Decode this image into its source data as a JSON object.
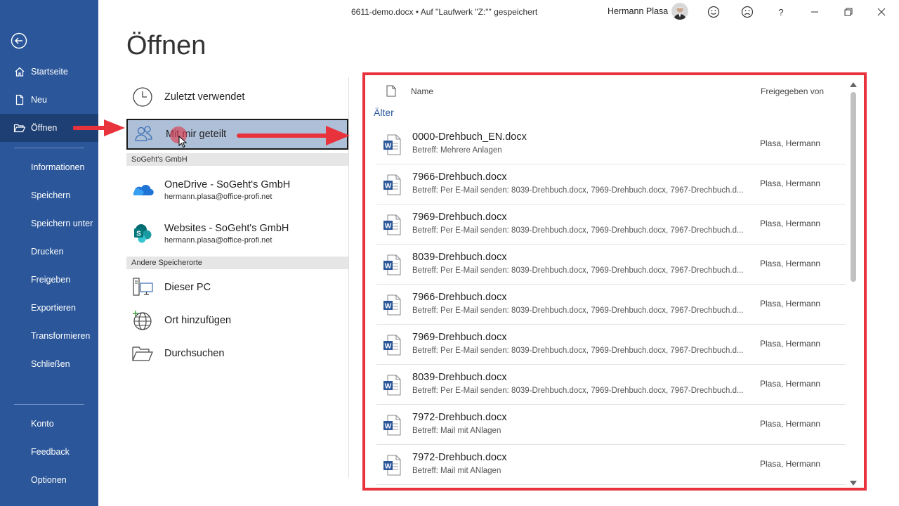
{
  "window": {
    "doc_title": "6611-demo.docx • Auf \"Laufwerk \"Z:\"\" gespeichert",
    "user_name": "Hermann Plasa",
    "buttons": {
      "smile": "smile-icon",
      "frown": "frown-icon",
      "help": "?",
      "minimize": "minimize-icon",
      "restore": "restore-icon",
      "close": "close-icon"
    }
  },
  "sidebar": {
    "top_items": [
      {
        "label": "Startseite",
        "icon": "home-icon"
      },
      {
        "label": "Neu",
        "icon": "new-document-icon"
      },
      {
        "label": "Öffnen",
        "icon": "open-folder-icon",
        "active": true
      }
    ],
    "mid_items": [
      {
        "label": "Informationen"
      },
      {
        "label": "Speichern"
      },
      {
        "label": "Speichern unter"
      },
      {
        "label": "Drucken"
      },
      {
        "label": "Freigeben"
      },
      {
        "label": "Exportieren"
      },
      {
        "label": "Transformieren"
      },
      {
        "label": "Schließen"
      }
    ],
    "bottom_items": [
      {
        "label": "Konto"
      },
      {
        "label": "Feedback"
      },
      {
        "label": "Optionen"
      }
    ]
  },
  "page": {
    "title": "Öffnen"
  },
  "locations": {
    "recent": "Zuletzt verwendet",
    "shared": "Mit mir geteilt",
    "section_org": "SoGeht's GmbH",
    "onedrive": {
      "label": "OneDrive - SoGeht's GmbH",
      "sub": "hermann.plasa@office-profi.net"
    },
    "sites": {
      "label": "Websites - SoGeht's GmbH",
      "sub": "hermann.plasa@office-profi.net"
    },
    "section_other": "Andere Speicherorte",
    "this_pc": "Dieser PC",
    "add_place": "Ort hinzufügen",
    "browse": "Durchsuchen"
  },
  "files": {
    "col_name": "Name",
    "col_shared_by": "Freigegeben von",
    "group": "Älter",
    "rows": [
      {
        "name": "0000-Drehbuch_EN.docx",
        "sub": "Betreff: Mehrere Anlagen",
        "owner": "Plasa, Hermann"
      },
      {
        "name": "7966-Drehbuch.docx",
        "sub": "Betreff: Per E-Mail senden: 8039-Drehbuch.docx, 7969-Drehbuch.docx, 7967-Drechbuch.d...",
        "owner": "Plasa, Hermann"
      },
      {
        "name": "7969-Drehbuch.docx",
        "sub": "Betreff: Per E-Mail senden: 8039-Drehbuch.docx, 7969-Drehbuch.docx, 7967-Drechbuch.d...",
        "owner": "Plasa, Hermann"
      },
      {
        "name": "8039-Drehbuch.docx",
        "sub": "Betreff: Per E-Mail senden: 8039-Drehbuch.docx, 7969-Drehbuch.docx, 7967-Drechbuch.d...",
        "owner": "Plasa, Hermann"
      },
      {
        "name": "7966-Drehbuch.docx",
        "sub": "Betreff: Per E-Mail senden: 8039-Drehbuch.docx, 7969-Drehbuch.docx, 7967-Drechbuch.d...",
        "owner": "Plasa, Hermann"
      },
      {
        "name": "7969-Drehbuch.docx",
        "sub": "Betreff: Per E-Mail senden: 8039-Drehbuch.docx, 7969-Drehbuch.docx, 7967-Drechbuch.d...",
        "owner": "Plasa, Hermann"
      },
      {
        "name": "8039-Drehbuch.docx",
        "sub": "Betreff: Per E-Mail senden: 8039-Drehbuch.docx, 7969-Drehbuch.docx, 7967-Drechbuch.d...",
        "owner": "Plasa, Hermann"
      },
      {
        "name": "7972-Drehbuch.docx",
        "sub": "Betreff: Mail mit ANlagen",
        "owner": "Plasa, Hermann"
      },
      {
        "name": "7972-Drehbuch.docx",
        "sub": "Betreff: Mail mit ANlagen",
        "owner": "Plasa, Hermann"
      }
    ]
  },
  "colors": {
    "accent": "#2b579a",
    "highlight_border": "#e8323c",
    "selected_bg": "#aebfd8"
  }
}
